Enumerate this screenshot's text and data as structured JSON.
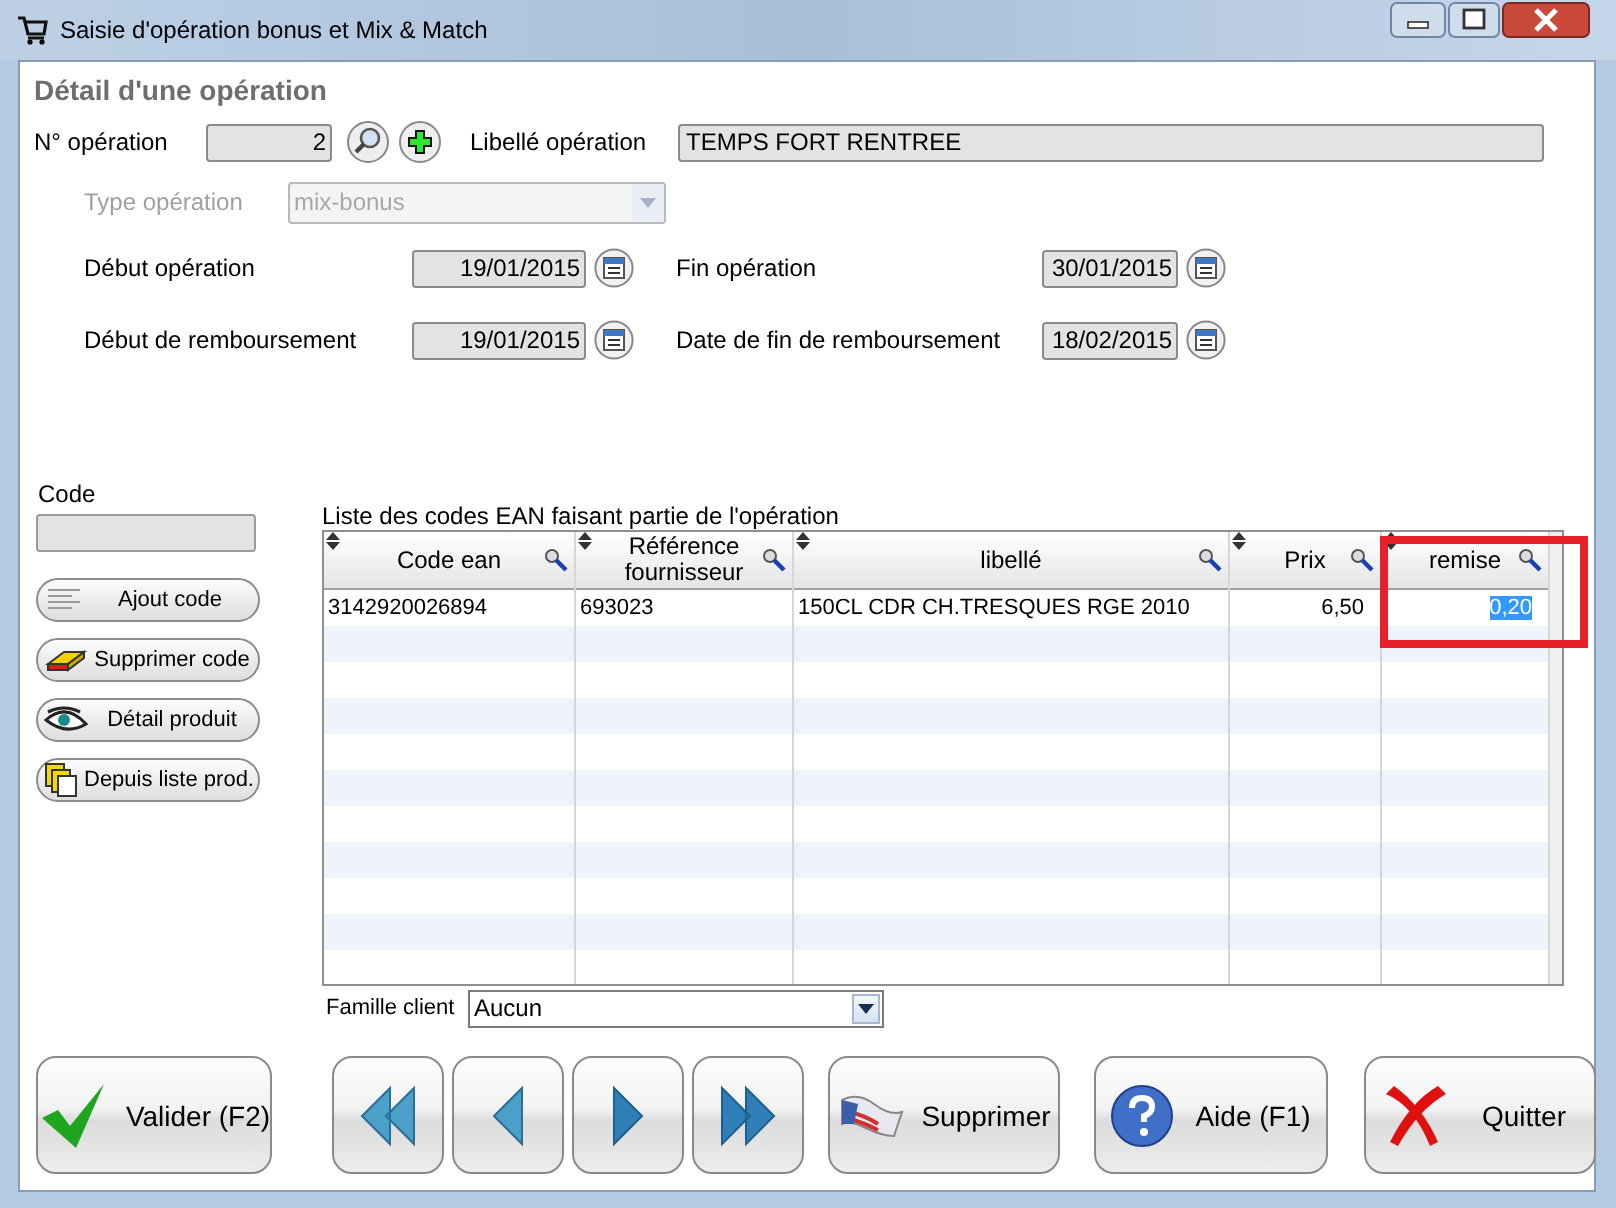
{
  "window": {
    "title": "Saisie d'opération bonus et Mix & Match"
  },
  "section_title": "Détail d'une opération",
  "operation": {
    "number_label": "N° opération",
    "number": "2",
    "name_label": "Libellé opération",
    "name": "TEMPS FORT RENTREE",
    "type_label": "Type opération",
    "type": "mix-bonus",
    "type_disabled": true
  },
  "dates": [
    {
      "label": "Début opération",
      "value": "19/01/2015"
    },
    {
      "label": "Fin opération",
      "value": "30/01/2015"
    },
    {
      "label": "Début de remboursement",
      "value": "19/01/2015"
    },
    {
      "label": "Date de fin de remboursement",
      "value": "18/02/2015"
    }
  ],
  "code": {
    "label": "Code"
  },
  "side_buttons": [
    {
      "kind": "list",
      "label": "Ajout code"
    },
    {
      "kind": "eraser",
      "label": "Supprimer code"
    },
    {
      "kind": "eye",
      "label": "Détail produit"
    },
    {
      "kind": "pages",
      "label": "Depuis liste prod."
    }
  ],
  "table": {
    "caption": "Liste des codes EAN faisant partie de l'opération",
    "columns": [
      {
        "label": "Code ean",
        "numeric": false,
        "highlighted": false
      },
      {
        "label": "Référence fournisseur",
        "numeric": false,
        "highlighted": false
      },
      {
        "label": "libellé",
        "numeric": false,
        "highlighted": false
      },
      {
        "label": "Prix",
        "numeric": true,
        "highlighted": false
      },
      {
        "label": "remise",
        "numeric": true,
        "highlighted": true
      }
    ],
    "rows": [
      {
        "cells": [
          "3142920026894",
          "693023",
          "150CL CDR CH.TRESQUES RGE 2010",
          "6,50",
          "0,20"
        ],
        "editing": true
      }
    ]
  },
  "family": {
    "label": "Famille client",
    "value": "Aucun"
  },
  "buttons": [
    {
      "kind": "validate",
      "label": "Valider (F2)"
    },
    {
      "kind": "first"
    },
    {
      "kind": "previous"
    },
    {
      "kind": "next"
    },
    {
      "kind": "last"
    },
    {
      "kind": "delete",
      "label": "Supprimer"
    },
    {
      "kind": "help",
      "label": "Aide (F1)"
    },
    {
      "kind": "quit",
      "label": "Quitter"
    }
  ]
}
